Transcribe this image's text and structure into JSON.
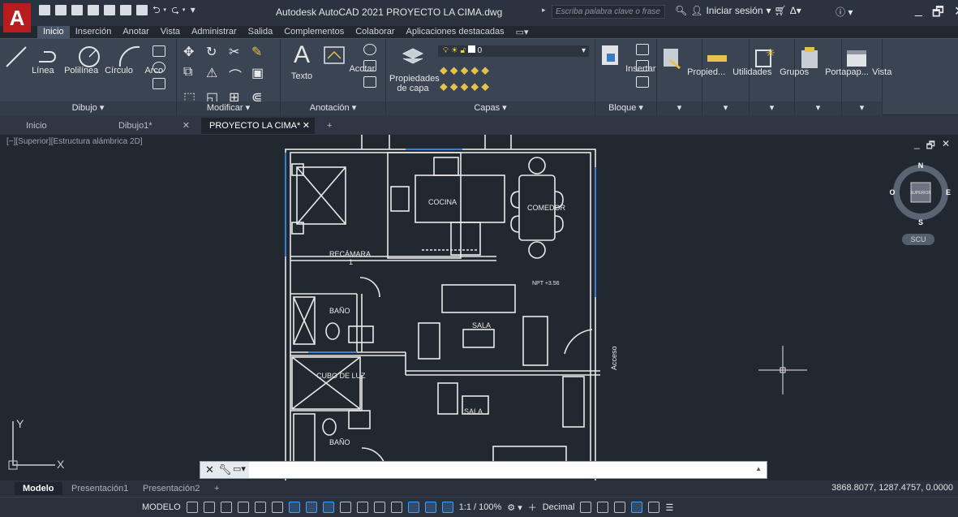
{
  "app": {
    "logo": "A",
    "title": "Autodesk AutoCAD 2021   PROYECTO LA CIMA.dwg",
    "search_placeholder": "Escriba palabra clave o frase",
    "sign_in": "Iniciar sesión",
    "window_controls": [
      "_",
      "🗗",
      "✕"
    ]
  },
  "ribbon_tabs": [
    "Inicio",
    "Inserción",
    "Anotar",
    "Vista",
    "Administrar",
    "Salida",
    "Complementos",
    "Colaborar",
    "Aplicaciones destacadas"
  ],
  "ribbon_panels": {
    "dibujo": {
      "title": "Dibujo ▾",
      "buttons": [
        "Línea",
        "Polilínea",
        "Círculo",
        "Arco"
      ]
    },
    "modificar": {
      "title": "Modificar ▾"
    },
    "anotacion": {
      "title": "Anotación ▾",
      "buttons": [
        "Texto",
        "Acotar"
      ]
    },
    "capas": {
      "title": "Capas ▾",
      "props_label_1": "Propiedades",
      "props_label_2": "de capa",
      "current_layer": "0"
    },
    "bloque": {
      "title": "Bloque ▾",
      "buttons": [
        "Insertar"
      ]
    },
    "propiedades": {
      "label": "Propied..."
    },
    "utilidades": {
      "label": "Utilidades"
    },
    "grupos": {
      "label": "Grupos"
    },
    "portapapeles": {
      "label": "Portapap..."
    },
    "vista": {
      "label": "Vista"
    }
  },
  "file_tabs": [
    {
      "label": "Inicio"
    },
    {
      "label": "Dibujo1*"
    },
    {
      "label": "PROYECTO LA CIMA*"
    }
  ],
  "viewport": {
    "label": "[−][Superior][Estructura alámbrica 2D]",
    "controls": [
      "_",
      "🗗",
      "✕"
    ]
  },
  "viewcube": {
    "n": "N",
    "s": "S",
    "e": "E",
    "w": "O",
    "face": "SUPERIOR",
    "wcs": "SCU"
  },
  "floorplan_labels": {
    "cocina": "COCINA",
    "comedor": "COMEDOR",
    "recamara": "RECÁMARA",
    "recamara_num": "1",
    "bano1": "BAÑO",
    "bano2": "BAÑO",
    "sala1": "SALA",
    "sala2": "SALA",
    "cubo": "CUBO DE LUZ",
    "npt": "NPT +3.56",
    "acceso": "Acceso"
  },
  "ucs": {
    "x": "X",
    "y": "Y"
  },
  "command_line": {
    "value": ""
  },
  "layout_tabs": [
    "Modelo",
    "Presentación1",
    "Presentación2"
  ],
  "coordinates": "3868.8077, 1287.4757, 0.0000",
  "status_bar": {
    "model": "MODELO",
    "scale": "1:1 / 100%",
    "units": "Decimal"
  },
  "colors": {
    "accent": "#3ea0ff",
    "background": "#212830",
    "logo": "#b81c1c"
  }
}
